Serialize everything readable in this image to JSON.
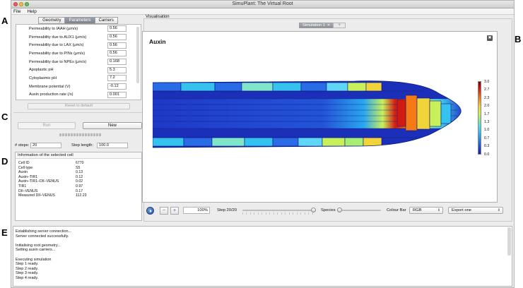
{
  "figure_labels": {
    "a": "A",
    "b": "B",
    "c": "C",
    "d": "D",
    "e": "E"
  },
  "window": {
    "title": "SimuPlant: The Virtual Root"
  },
  "menu": {
    "file": "File",
    "help": "Help"
  },
  "param_tabs": {
    "geometry": "Geometry",
    "parameters": "Parameters",
    "carriers": "Carriers"
  },
  "parameters": [
    {
      "label": "Permeability to IAAH (μm/s)",
      "value": "0.56"
    },
    {
      "label": "Permeability due to AUX1 (μm/s)",
      "value": "0.56"
    },
    {
      "label": "Permeability due to LAX (μm/s)",
      "value": "0.56"
    },
    {
      "label": "Permeability due to PINs (μm/s)",
      "value": "0.56"
    },
    {
      "label": "Permeability due to NPEs (μm/s)",
      "value": "0.168"
    },
    {
      "label": "Apoplastic pH",
      "value": "5.3"
    },
    {
      "label": "Cytoplasmic pH",
      "value": "7.2"
    },
    {
      "label": "Membrane potential (V)",
      "value": "-0.12"
    },
    {
      "label": "Auxin production rate (/s)",
      "value": "0.001"
    }
  ],
  "reset_label": "Reset to default",
  "run_label": "Run",
  "new_label": "New",
  "steps": {
    "label": "# steps:",
    "value": "20",
    "length_label": "Step length:",
    "length_value": "100.0"
  },
  "cell_info": {
    "header": "Information of the selected cell",
    "rows": [
      {
        "key": "Cell ID",
        "value": "6770"
      },
      {
        "key": "Cell type",
        "value": "S5"
      },
      {
        "key": "Auxin",
        "value": "0.13"
      },
      {
        "key": "Auxin–TIR1",
        "value": "0.12"
      },
      {
        "key": "Auxin–TIR1–DII–VENUS",
        "value": "0.02"
      },
      {
        "key": "TIR1",
        "value": "0.97"
      },
      {
        "key": "DII–VENUS",
        "value": "0.17"
      },
      {
        "key": "Measured DII–VENUS",
        "value": "112.23"
      }
    ]
  },
  "visualisation": {
    "label": "Visualisation",
    "tab": "Simulation 1",
    "add_tab": "+",
    "canvas_title": "Auxin",
    "close": "✖",
    "legend_ticks": [
      "3.0",
      "2.7",
      "2.3",
      "2.0",
      "1.7",
      "1.3",
      "1.0",
      "0.7",
      "0.3",
      "0.0"
    ],
    "colors": {
      "low": "#1b1fa4",
      "mid": "#c8f05a",
      "high": "#7a0000"
    }
  },
  "controls": {
    "zoom": "100%",
    "step_label": "Step 20/20",
    "step_fraction": 1.0,
    "species_label": "Species",
    "species_fraction": 0.05,
    "colour_bar_label": "Colour Bar",
    "colour_bar_value": "RGB",
    "export_value": "Export one",
    "zoom_out_icon": "zoom-out-icon",
    "zoom_in_icon": "zoom-in-icon"
  },
  "console": {
    "lines": [
      "Establishing server connection...",
      "Server connected successfully.",
      "",
      "Initialising root geometry...",
      "Setting auxin carriers...",
      "",
      "Executing simulation",
      "Step 1 ready.",
      "Step 2 ready.",
      "Step 3 ready.",
      "Step 4 ready."
    ]
  }
}
